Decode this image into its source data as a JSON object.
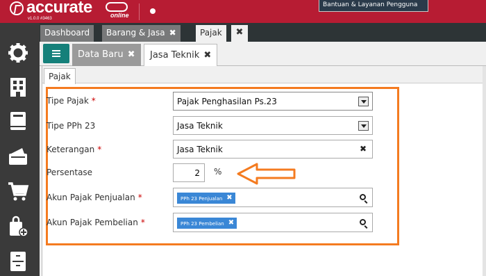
{
  "app": {
    "brand": "accurate",
    "brand_sub": "online",
    "version": "v1.0.0 #3463",
    "help_button": "Bantuan & Layanan Pengguna"
  },
  "main_tabs": [
    {
      "label": "Dashboard",
      "active": false,
      "closable": false
    },
    {
      "label": "Barang & Jasa",
      "active": false,
      "closable": true
    },
    {
      "label": "Pajak",
      "active": true,
      "closable": true
    }
  ],
  "sub_tabs": [
    {
      "label": "Data Baru",
      "active": false
    },
    {
      "label": "Jasa Teknik",
      "active": true
    }
  ],
  "section_tab": "Pajak",
  "form": {
    "tipe_pajak": {
      "label": "Tipe Pajak",
      "value": "Pajak Penghasilan Ps.23"
    },
    "tipe_pph23": {
      "label": "Tipe PPh 23",
      "value": "Jasa Teknik"
    },
    "keterangan": {
      "label": "Keterangan",
      "value": "Jasa Teknik"
    },
    "persentase": {
      "label": "Persentase",
      "value": "2",
      "unit": "%"
    },
    "akun_penjualan": {
      "label": "Akun Pajak Penjualan",
      "chip": "PPh 23 Penjualan"
    },
    "akun_pembelian": {
      "label": "Akun Pajak Pembelian",
      "chip": "PPh 23 Pembelian"
    },
    "required_mark": "*"
  },
  "sidebar_icons": [
    "gear-icon",
    "building-icon",
    "book-icon",
    "wallet-icon",
    "cart-icon",
    "bag-add-icon",
    "cabinet-icon"
  ],
  "colors": {
    "topbar": "#b71c33",
    "sidebar": "#3a3a3a",
    "highlight": "#f47b20",
    "chip": "#3a87d6",
    "menu_button": "#15807a"
  }
}
